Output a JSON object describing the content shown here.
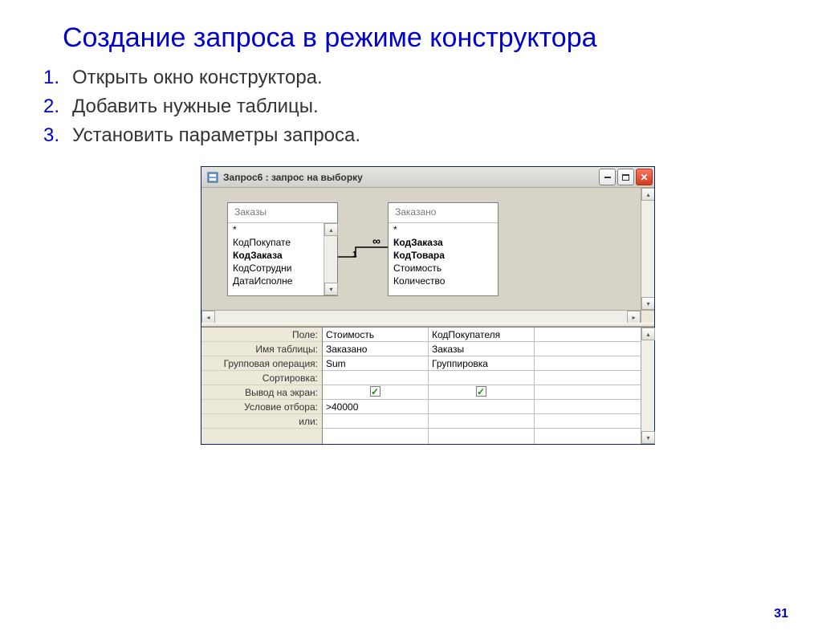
{
  "slide": {
    "title": "Создание запроса в режиме конструктора",
    "steps": [
      "Открыть окно конструктора.",
      "Добавить нужные таблицы.",
      "Установить параметры запроса."
    ],
    "page_number": "31"
  },
  "window": {
    "title": "Запрос6 : запрос на выборку",
    "tables": [
      {
        "name": "Заказы",
        "fields": [
          "*",
          "КодПокупате",
          "КодЗаказа",
          "КодСотрудни",
          "ДатаИсполне"
        ],
        "bold": [
          2
        ]
      },
      {
        "name": "Заказано",
        "fields": [
          "*",
          "КодЗаказа",
          "КодТовара",
          "Стоимость",
          "Количество"
        ],
        "bold": [
          1,
          2
        ]
      }
    ],
    "relation": {
      "left_label": "1",
      "right_label": "∞"
    },
    "grid": {
      "row_labels": [
        "Поле:",
        "Имя таблицы:",
        "Групповая операция:",
        "Сортировка:",
        "Вывод на экран:",
        "Условие отбора:",
        "или:"
      ],
      "columns": [
        {
          "field": "Стоимость",
          "table": "Заказано",
          "agg": "Sum",
          "sort": "",
          "show": true,
          "criteria": ">40000",
          "or": ""
        },
        {
          "field": "КодПокупателя",
          "table": "Заказы",
          "agg": "Группировка",
          "sort": "",
          "show": true,
          "criteria": "",
          "or": ""
        }
      ]
    }
  }
}
